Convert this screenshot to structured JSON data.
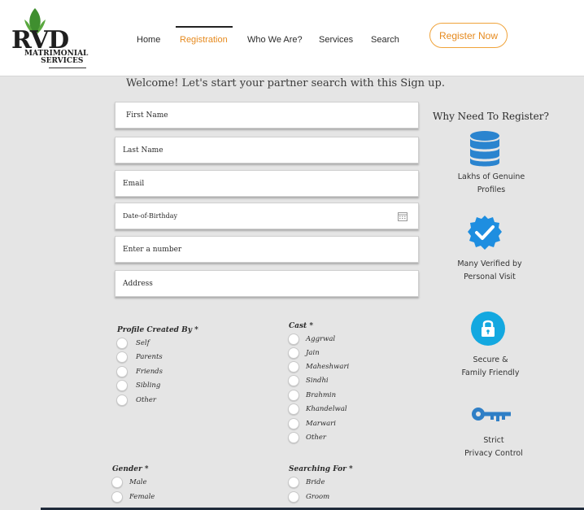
{
  "brand": {
    "logo_main": "RVD",
    "logo_sub_1": "MATRIMONIAL",
    "logo_sub_2": "SERVICES",
    "colors": {
      "accent": "#e68a1e",
      "leaf": "#3f8f2f",
      "icon_blue": "#1e88d2"
    }
  },
  "nav": {
    "items": [
      {
        "label": "Home"
      },
      {
        "label": "Registration",
        "active": true
      },
      {
        "label": "Who We Are?"
      },
      {
        "label": "Services"
      },
      {
        "label": "Search"
      }
    ],
    "register_button": "Register Now"
  },
  "form": {
    "welcome": "Welcome! Let's start your partner search with this Sign up.",
    "fields": {
      "first_name": {
        "placeholder": "First Name",
        "value": ""
      },
      "last_name": {
        "placeholder": "Last Name",
        "value": ""
      },
      "email": {
        "placeholder": "Email",
        "value": ""
      },
      "dob": {
        "placeholder": "Date-of-Birthday",
        "value": ""
      },
      "phone": {
        "placeholder": "Enter a number",
        "value": ""
      },
      "address": {
        "placeholder": "Address",
        "value": ""
      }
    },
    "profile_created_by": {
      "title": "Profile Created By *",
      "options": [
        "Self",
        "Parents",
        "Friends",
        "Sibling",
        "Other"
      ]
    },
    "cast": {
      "title": "Cast *",
      "options": [
        "Aggrwal",
        "Jain",
        "Maheshwari",
        "Sindhi",
        "Brahmin",
        "Khandelwal",
        "Marwari",
        "Other"
      ]
    },
    "gender": {
      "title": "Gender *",
      "options": [
        "Male",
        "Female"
      ]
    },
    "searching_for": {
      "title": "Searching For *",
      "options": [
        "Bride",
        "Groom"
      ]
    }
  },
  "sidebar": {
    "title": "Why Need To Register?",
    "features": [
      {
        "icon": "database-icon",
        "line1": "Lakhs of Genuine",
        "line2": "Profiles"
      },
      {
        "icon": "verified-badge-icon",
        "line1": "Many Verified by",
        "line2": "Personal Visit"
      },
      {
        "icon": "lock-icon",
        "line1": "Secure &",
        "line2": "Family Friendly"
      },
      {
        "icon": "key-icon",
        "line1": "Strict",
        "line2": "Privacy Control"
      }
    ]
  }
}
